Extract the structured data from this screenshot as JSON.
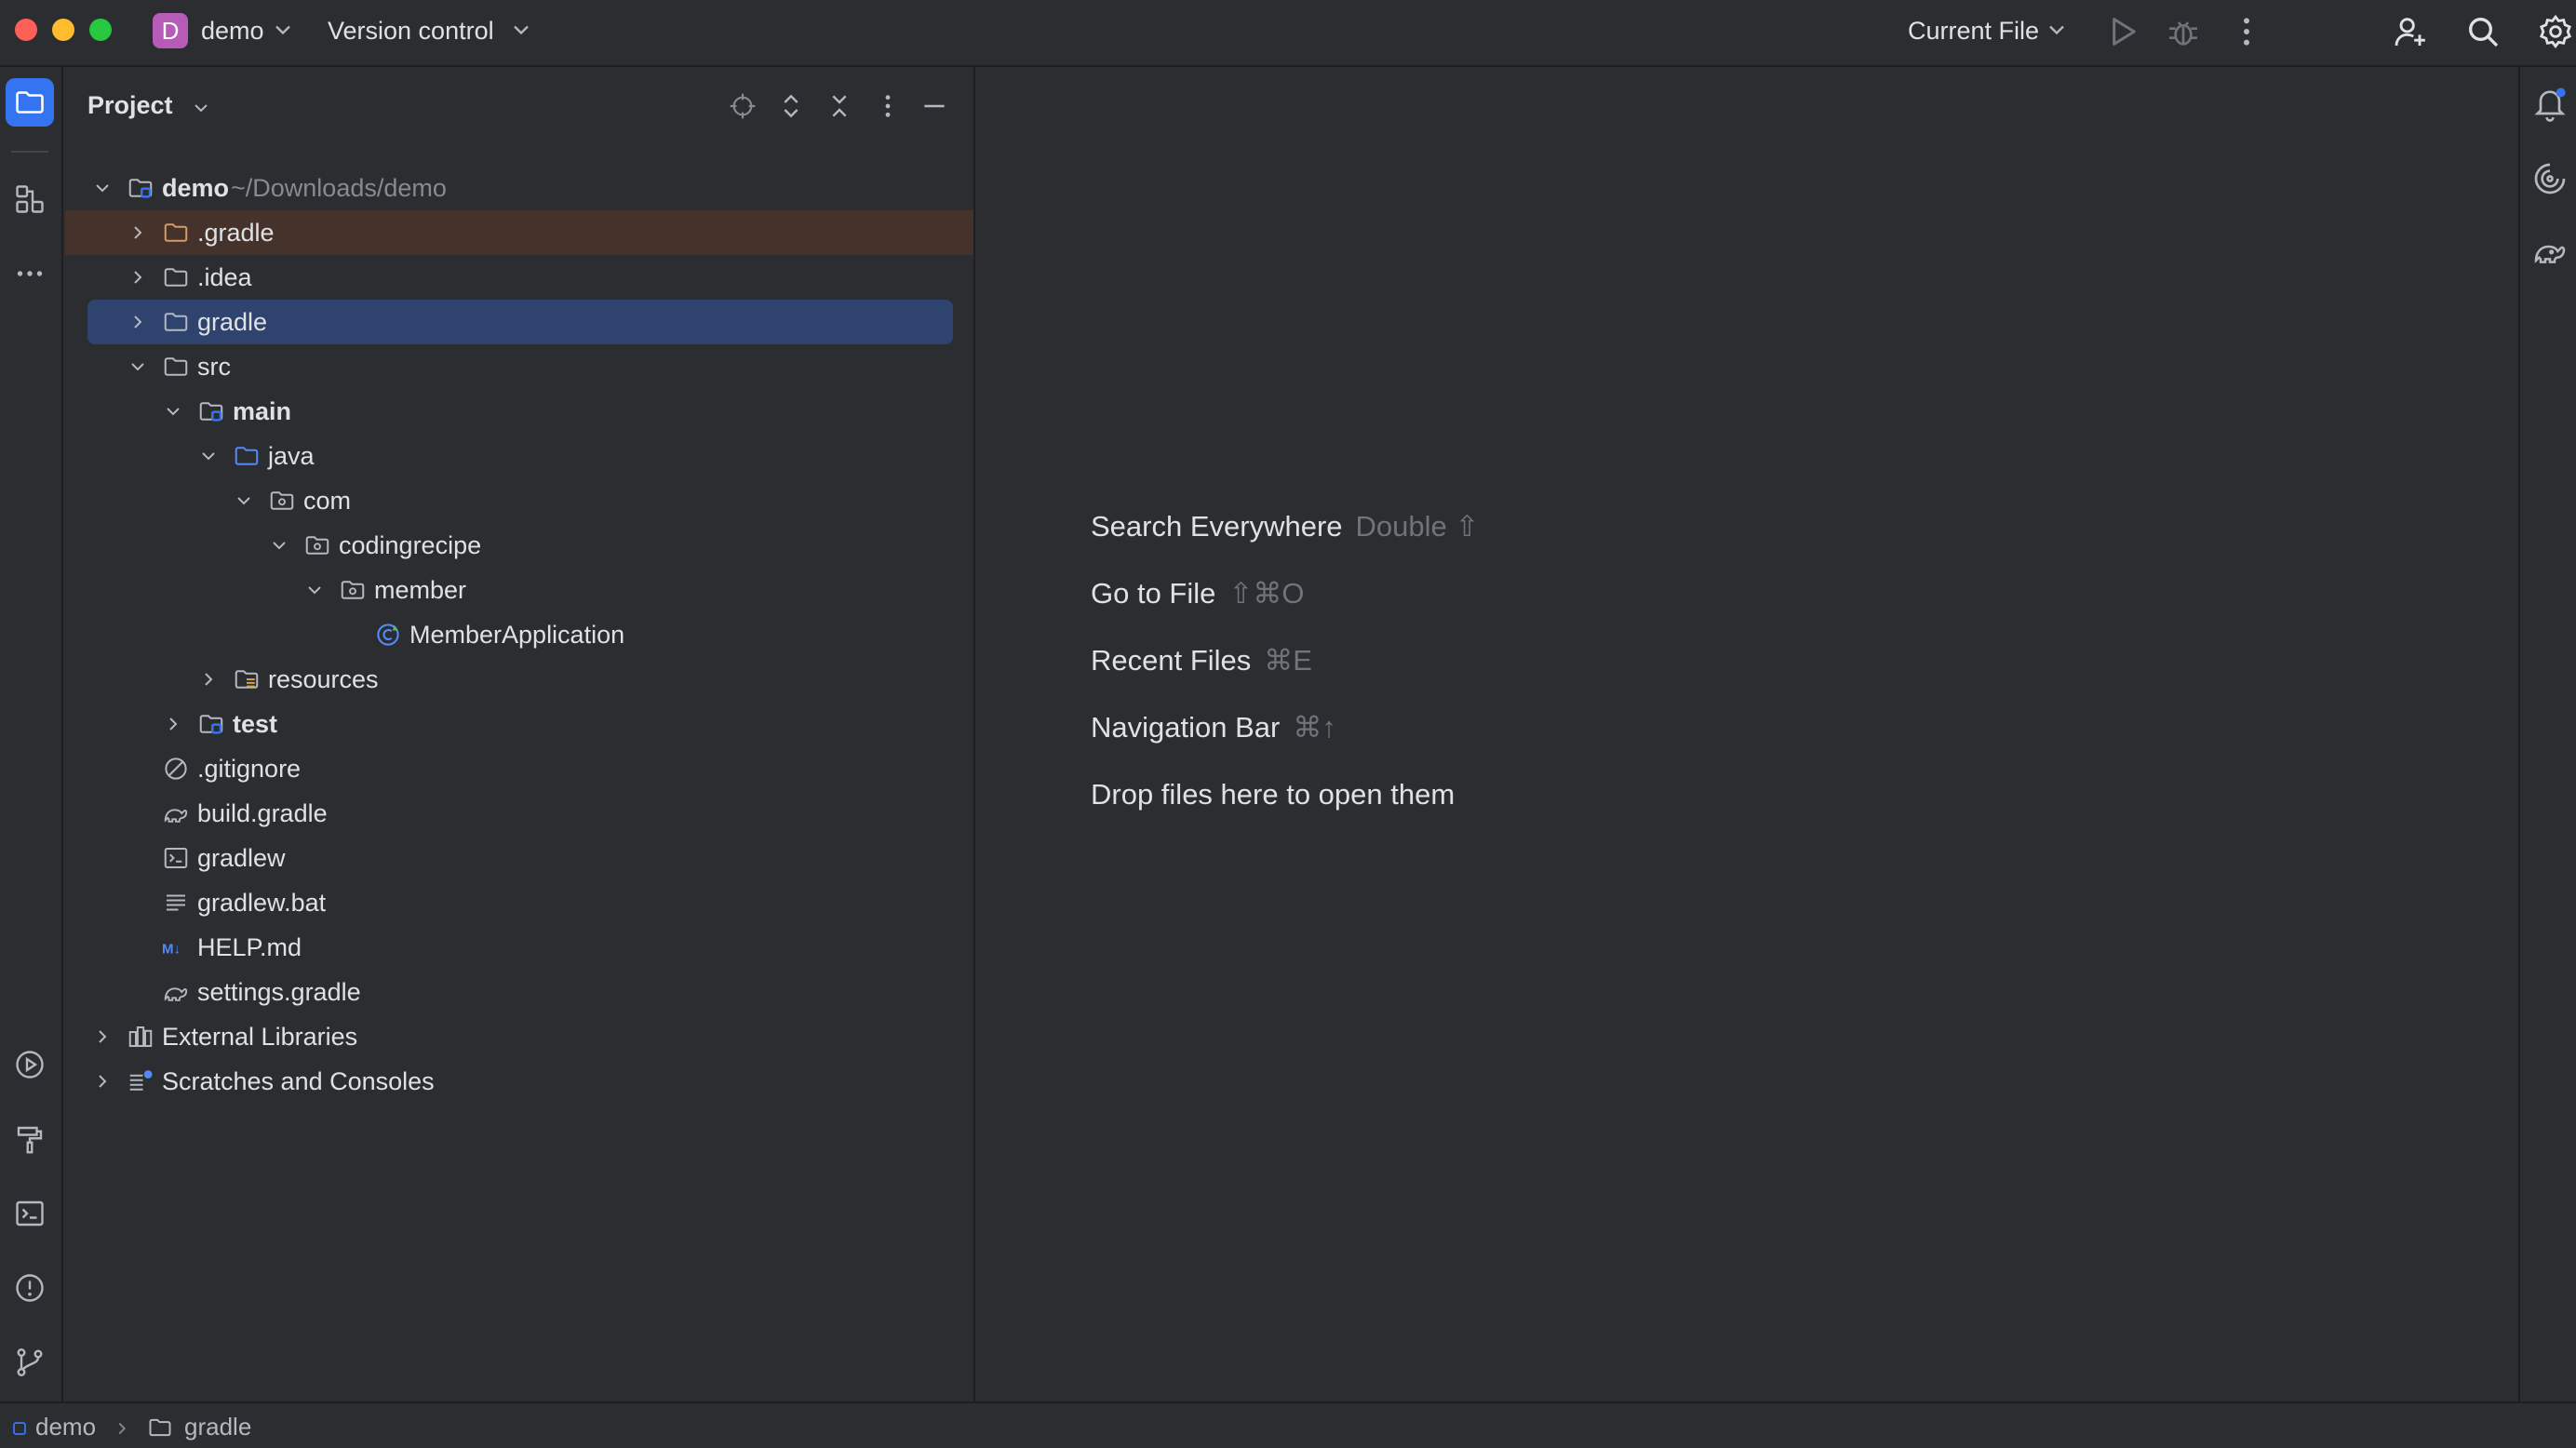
{
  "titlebar": {
    "project_badge": "D",
    "project_name": "demo",
    "vcs_label": "Version control",
    "run_config": "Current File",
    "icons": [
      "chevron-down-icon",
      "play-icon",
      "bug-icon",
      "more-vertical-icon",
      "add-user-icon",
      "search-icon",
      "settings-icon"
    ]
  },
  "left_strip": {
    "top_icons": [
      "folder-icon",
      "structure-icon",
      "more-horizontal-icon"
    ],
    "bottom_icons": [
      "run-icon",
      "build-icon",
      "terminal-icon",
      "problems-icon",
      "git-branch-icon"
    ]
  },
  "project_panel": {
    "title": "Project",
    "header_icons": [
      "locate-icon",
      "expand-all-icon",
      "collapse-all-icon",
      "more-vertical-icon",
      "minimize-icon"
    ],
    "tree": [
      {
        "label": "demo",
        "path": "~/Downloads/demo",
        "bold": true,
        "depth": 0,
        "expanded": true,
        "icon": "module-folder"
      },
      {
        "label": ".gradle",
        "depth": 1,
        "expanded": false,
        "icon": "folder-orange",
        "highlight": true
      },
      {
        "label": ".idea",
        "depth": 1,
        "expanded": false,
        "icon": "folder"
      },
      {
        "label": "gradle",
        "depth": 1,
        "expanded": false,
        "icon": "folder",
        "selected": true
      },
      {
        "label": "src",
        "depth": 1,
        "expanded": true,
        "icon": "folder"
      },
      {
        "label": "main",
        "bold": true,
        "depth": 2,
        "expanded": true,
        "icon": "module-folder"
      },
      {
        "label": "java",
        "depth": 3,
        "expanded": true,
        "icon": "source-folder"
      },
      {
        "label": "com",
        "depth": 4,
        "expanded": true,
        "icon": "package"
      },
      {
        "label": "codingrecipe",
        "depth": 5,
        "expanded": true,
        "icon": "package"
      },
      {
        "label": "member",
        "depth": 6,
        "expanded": true,
        "icon": "package"
      },
      {
        "label": "MemberApplication",
        "depth": 7,
        "icon": "spring-class"
      },
      {
        "label": "resources",
        "depth": 3,
        "expanded": false,
        "icon": "resources-folder"
      },
      {
        "label": "test",
        "bold": true,
        "depth": 2,
        "expanded": false,
        "icon": "module-folder"
      },
      {
        "label": ".gitignore",
        "depth": 1,
        "icon": "ignore-file"
      },
      {
        "label": "build.gradle",
        "depth": 1,
        "icon": "gradle-file"
      },
      {
        "label": "gradlew",
        "depth": 1,
        "icon": "shell-file"
      },
      {
        "label": "gradlew.bat",
        "depth": 1,
        "icon": "text-file"
      },
      {
        "label": "HELP.md",
        "depth": 1,
        "icon": "markdown-file"
      },
      {
        "label": "settings.gradle",
        "depth": 1,
        "icon": "gradle-file"
      },
      {
        "label": "External Libraries",
        "depth": 0,
        "expanded": false,
        "icon": "libraries"
      },
      {
        "label": "Scratches and Consoles",
        "depth": 0,
        "expanded": false,
        "icon": "scratches"
      }
    ]
  },
  "editor_hints": [
    {
      "label": "Search Everywhere",
      "shortcut": "Double ⇧"
    },
    {
      "label": "Go to File",
      "shortcut": "⇧⌘O"
    },
    {
      "label": "Recent Files",
      "shortcut": "⌘E"
    },
    {
      "label": "Navigation Bar",
      "shortcut": "⌘↑"
    },
    {
      "label": "Drop files here to open them",
      "shortcut": ""
    }
  ],
  "right_strip": {
    "icons": [
      "notifications-icon",
      "ai-assistant-icon",
      "gradle-icon"
    ]
  },
  "status_bar": {
    "crumbs": [
      "demo",
      "gradle"
    ]
  },
  "colors": {
    "background": "#2b2d30",
    "accent": "#3574f0",
    "selection": "#2e436e",
    "highlight_row": "#45322b",
    "badge": "#b75bb8"
  }
}
